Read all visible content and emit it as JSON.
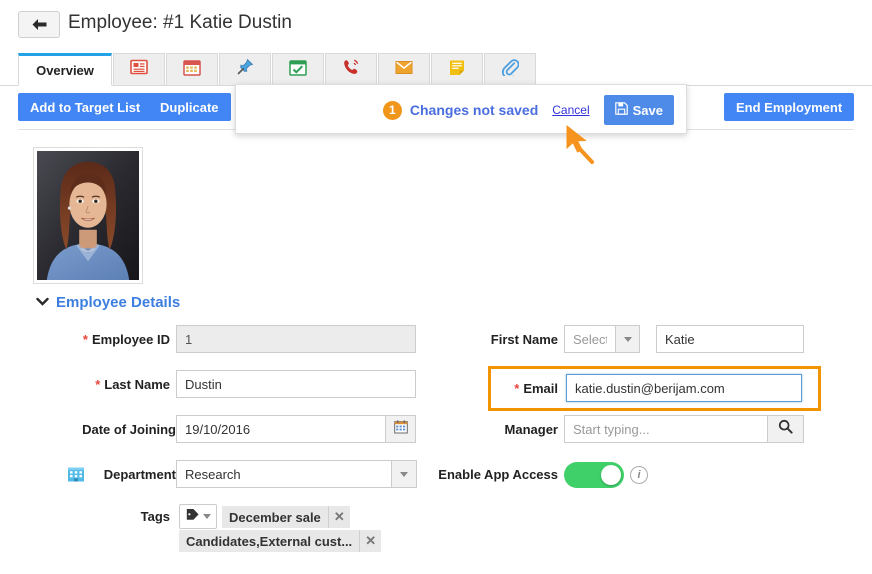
{
  "header": {
    "title": "Employee: #1 Katie Dustin",
    "back_icon": "arrow-left-icon"
  },
  "tabs": [
    {
      "label": "Overview",
      "icon": "overview-text",
      "active": true
    },
    {
      "label": "",
      "icon": "list-red-icon",
      "active": false
    },
    {
      "label": "",
      "icon": "calendar-red-icon",
      "active": false
    },
    {
      "label": "",
      "icon": "pin-blue-icon",
      "active": false
    },
    {
      "label": "",
      "icon": "calendar-check-green-icon",
      "active": false
    },
    {
      "label": "",
      "icon": "phone-red-icon",
      "active": false
    },
    {
      "label": "",
      "icon": "envelope-orange-icon",
      "active": false
    },
    {
      "label": "",
      "icon": "note-yellow-icon",
      "active": false
    },
    {
      "label": "",
      "icon": "paperclip-blue-icon",
      "active": false
    }
  ],
  "actions": {
    "add_to_target_list": "Add to Target List",
    "duplicate": "Duplicate",
    "end_employment": "End Employment"
  },
  "popup": {
    "count": "1",
    "message": "Changes not saved",
    "cancel": "Cancel",
    "save": "Save",
    "save_icon": "floppy-disk-icon",
    "badge_color": "#f0971b",
    "save_button_color": "#4e8ae8"
  },
  "details": {
    "section_title": "Employee Details",
    "left_fields": [
      {
        "label": "Employee ID",
        "required": true,
        "value": "1",
        "readonly": true
      },
      {
        "label": "Last Name",
        "required": true,
        "value": "Dustin",
        "readonly": false
      },
      {
        "label": "Date of Joining",
        "required": false,
        "value": "19/10/2016",
        "readonly": false,
        "addon_icon": "calendar-icon"
      },
      {
        "label": "Department",
        "required": false,
        "value": "Research",
        "readonly": false,
        "icon": "building-icon",
        "addon_icon": "chevron-down-icon"
      }
    ],
    "right_fields": [
      {
        "label": "First Name",
        "required": false,
        "salutation_placeholder": "Select one",
        "value": "Katie"
      },
      {
        "label": "Email",
        "required": true,
        "value": "katie.dustin@berijam.com",
        "focused": true,
        "highlight_color": "#f29400"
      },
      {
        "label": "Manager",
        "required": false,
        "value": "",
        "placeholder": "Start typing...",
        "addon_icon": "search-icon"
      },
      {
        "label": "Enable App Access",
        "required": false,
        "toggle_on": true,
        "toggle_color": "#3fd06a",
        "info_icon": "info-icon"
      }
    ],
    "tags": {
      "label": "Tags",
      "dropdown_icon": "tag-icon",
      "chips": [
        {
          "text": "December sale",
          "remove_icon": "close-icon"
        },
        {
          "text": "Candidates,External cust...",
          "remove_icon": "close-icon"
        }
      ]
    }
  },
  "cursor": {
    "icon": "arrow-cursor",
    "color": "#f5931e"
  }
}
